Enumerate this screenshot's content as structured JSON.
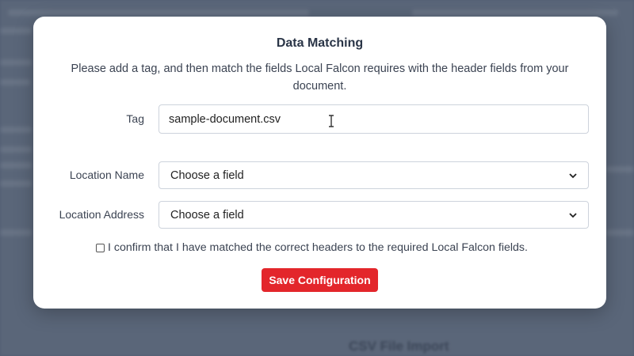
{
  "background": {
    "heading": "CSV File Import"
  },
  "modal": {
    "title": "Data Matching",
    "description": "Please add a tag, and then match the fields Local Falcon requires with the header fields from your document.",
    "tag": {
      "label": "Tag",
      "value": "sample-document.csv"
    },
    "location_name": {
      "label": "Location Name",
      "selected": "Choose a field"
    },
    "location_address": {
      "label": "Location Address",
      "selected": "Choose a field"
    },
    "confirm": {
      "label": "I confirm that I have matched the correct headers to the required Local Falcon fields.",
      "checked": false
    },
    "save_label": "Save Configuration"
  },
  "colors": {
    "accent": "#e3262b",
    "title": "#2a3547",
    "backdrop": "#5d6a80"
  }
}
